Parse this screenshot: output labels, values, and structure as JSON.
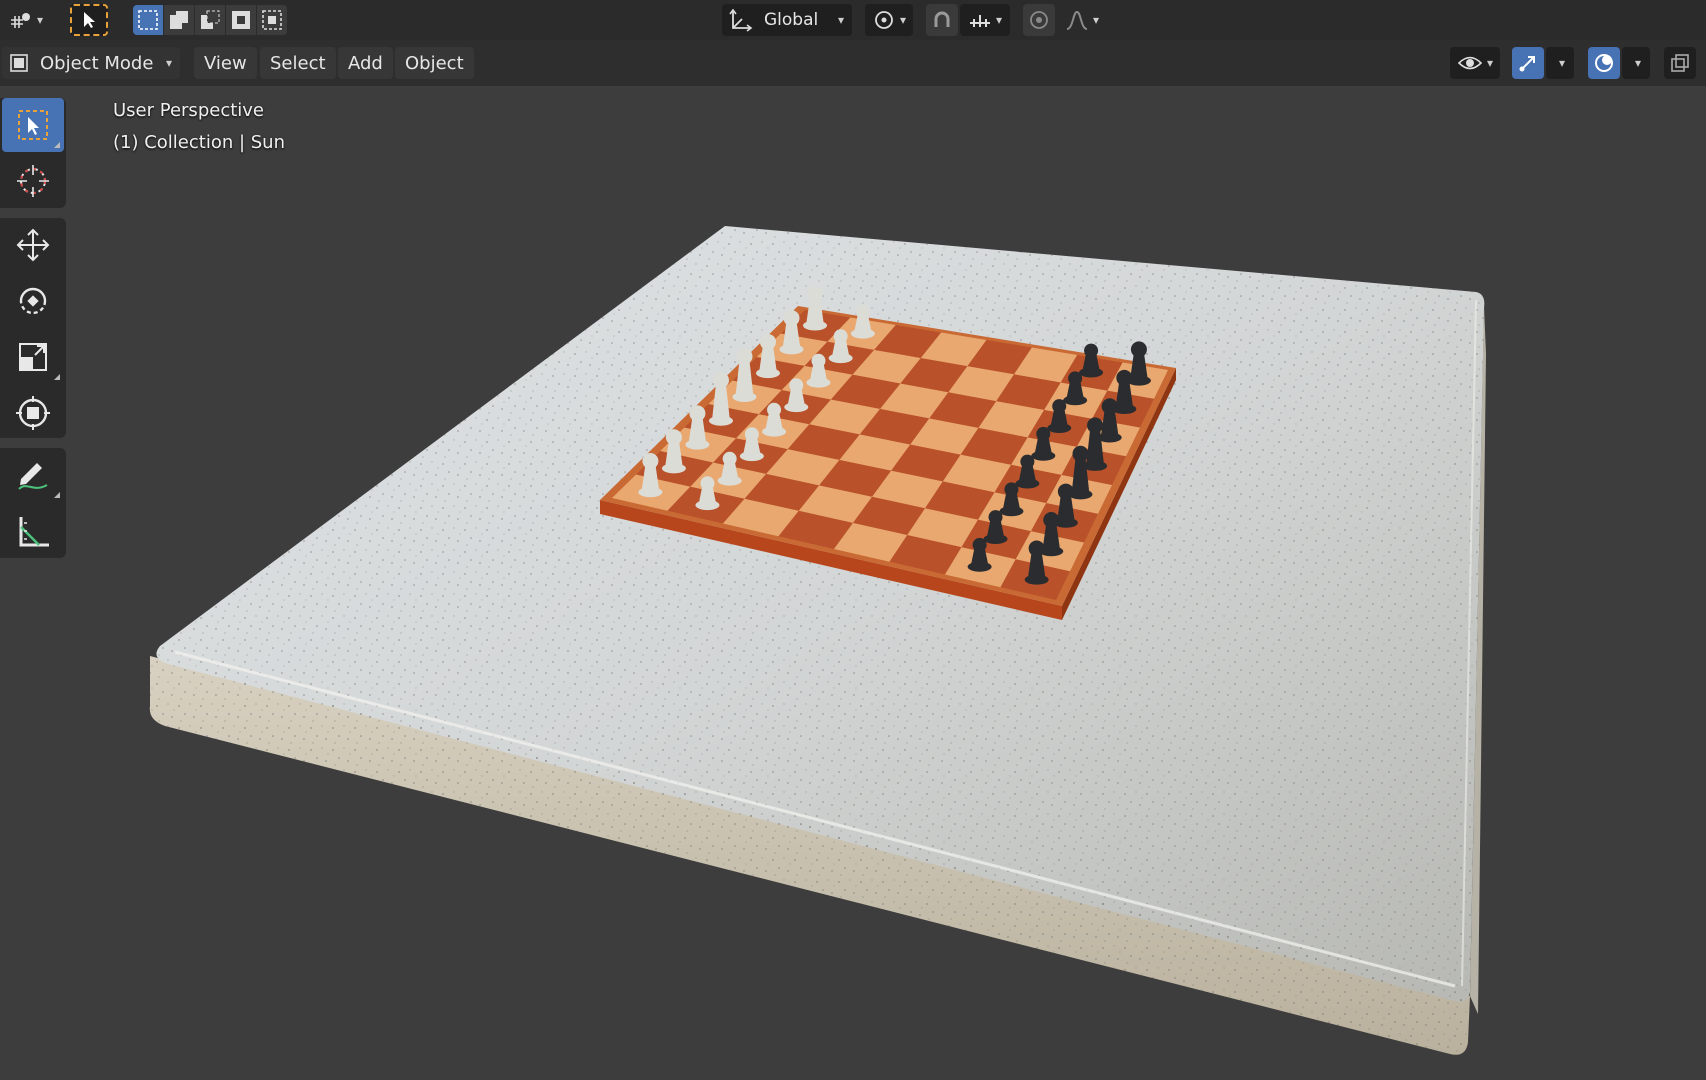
{
  "header": {
    "transform_orientation": "Global"
  },
  "header2": {
    "mode_label": "Object Mode",
    "menu": [
      "View",
      "Select",
      "Add",
      "Object"
    ]
  },
  "viewport": {
    "perspective_label": "User Perspective",
    "collection_label": "(1) Collection | Sun"
  },
  "toolbar": {
    "tools": [
      "select-box",
      "cursor",
      "move",
      "rotate",
      "scale",
      "transform",
      "annotate",
      "measure"
    ],
    "active_tool": "select-box"
  },
  "colors": {
    "accent": "#4772b3",
    "background": "#3d3d3d",
    "header": "#2b2b2b"
  }
}
